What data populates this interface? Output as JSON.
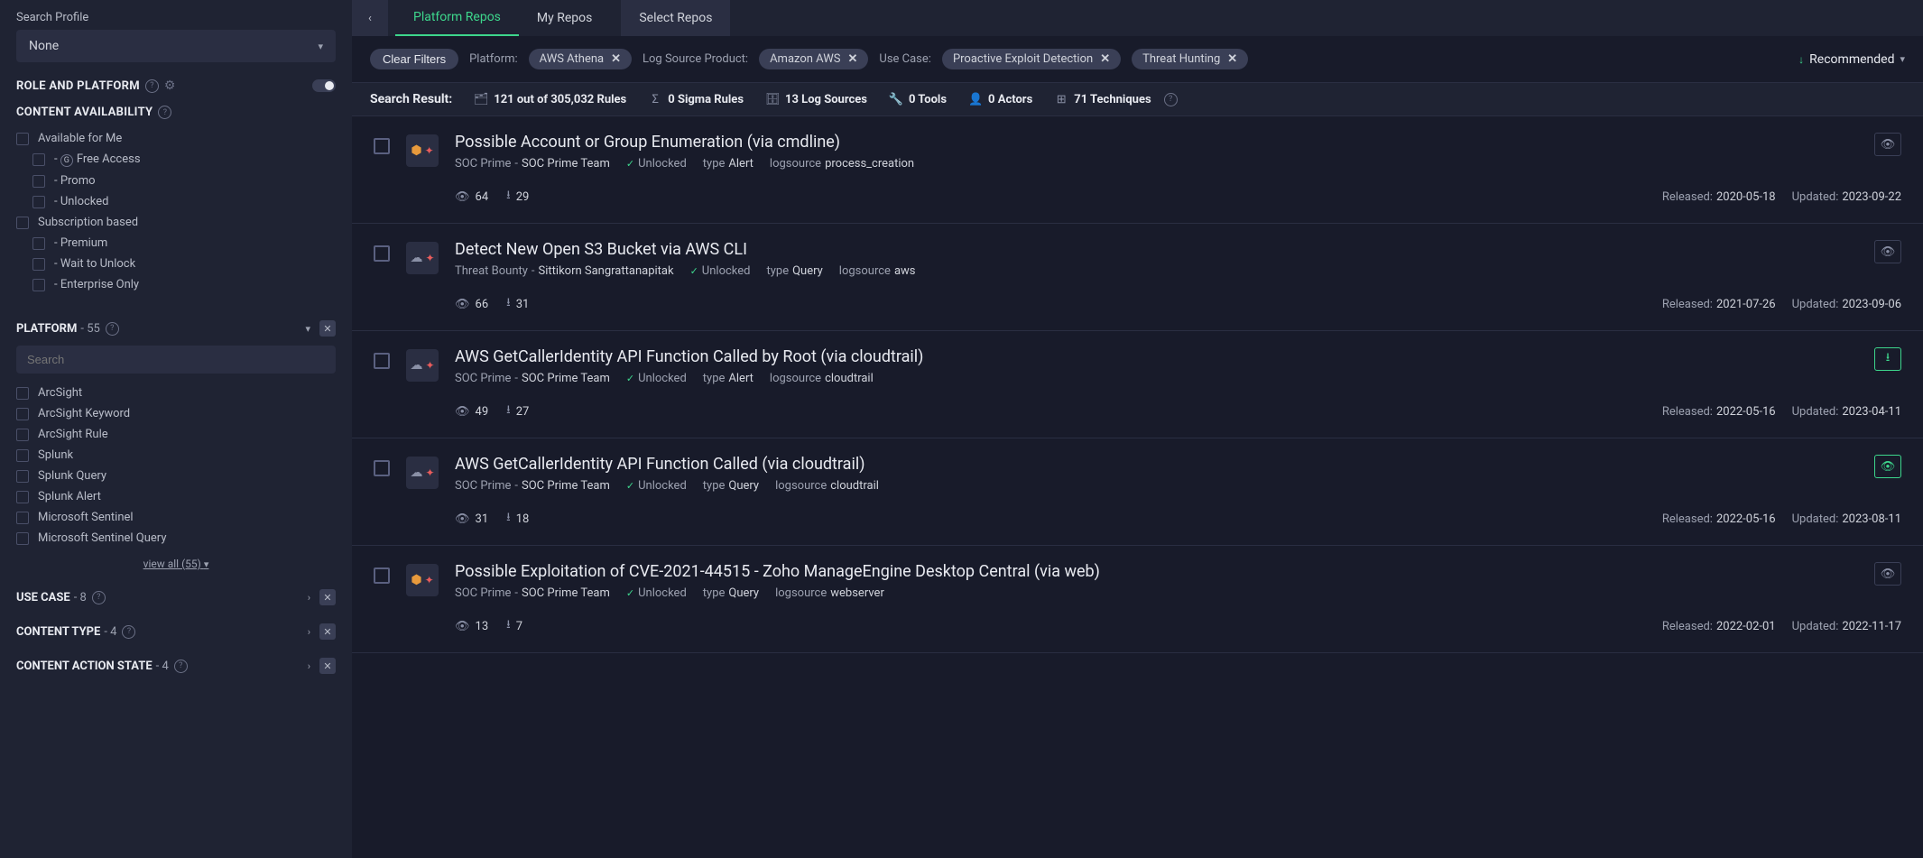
{
  "sidebar": {
    "search_profile_label": "Search Profile",
    "profile_value": "None",
    "role_platform_title": "ROLE AND PLATFORM",
    "content_availability_title": "CONTENT AVAILABILITY",
    "availability": [
      {
        "label": "Available for Me",
        "indent": false,
        "icon": false
      },
      {
        "label": "Free Access",
        "indent": true,
        "icon": true
      },
      {
        "label": "Promo",
        "indent": true,
        "icon": false
      },
      {
        "label": "Unlocked",
        "indent": true,
        "icon": false
      },
      {
        "label": "Subscription based",
        "indent": false,
        "icon": false
      },
      {
        "label": "Premium",
        "indent": true,
        "icon": false
      },
      {
        "label": "Wait to Unlock",
        "indent": true,
        "icon": false
      },
      {
        "label": "Enterprise Only",
        "indent": true,
        "icon": false
      }
    ],
    "platform_title": "PLATFORM",
    "platform_count": "55",
    "platform_search_placeholder": "Search",
    "platforms": [
      "ArcSight",
      "ArcSight Keyword",
      "ArcSight Rule",
      "Splunk",
      "Splunk Query",
      "Splunk Alert",
      "Microsoft Sentinel",
      "Microsoft Sentinel Query"
    ],
    "view_all_label": "view all (55)",
    "facets": [
      {
        "title": "USE CASE",
        "count": "8"
      },
      {
        "title": "CONTENT TYPE",
        "count": "4"
      },
      {
        "title": "CONTENT ACTION STATE",
        "count": "4"
      }
    ]
  },
  "tabs": {
    "platform": "Platform Repos",
    "my": "My Repos",
    "select": "Select Repos"
  },
  "filters": {
    "clear": "Clear Filters",
    "platform_label": "Platform:",
    "platform_value": "AWS Athena",
    "logsource_label": "Log Source Product:",
    "logsource_value": "Amazon AWS",
    "usecase_label": "Use Case:",
    "usecase_values": [
      "Proactive Exploit Detection",
      "Threat Hunting"
    ],
    "sort_label": "Recommended"
  },
  "stats": {
    "title": "Search Result:",
    "rules": "121 out of 305,032 Rules",
    "sigma": "0 Sigma Rules",
    "logsources": "13 Log Sources",
    "tools": "0 Tools",
    "actors": "0 Actors",
    "techniques": "71 Techniques"
  },
  "results": [
    {
      "title": "Possible Account or Group Enumeration (via cmdline)",
      "author_prefix": "SOC Prime",
      "author_name": "SOC Prime Team",
      "unlocked": "Unlocked",
      "type": "Alert",
      "logsource": "process_creation",
      "views": "64",
      "downloads": "29",
      "released": "2020-05-18",
      "updated": "2023-09-22",
      "icon_style": "shield",
      "action": "eye"
    },
    {
      "title": "Detect New Open S3 Bucket via AWS CLI",
      "author_prefix": "Threat Bounty",
      "author_name": "Sittikorn Sangrattanapitak",
      "unlocked": "Unlocked",
      "type": "Query",
      "logsource": "aws",
      "views": "66",
      "downloads": "31",
      "released": "2021-07-26",
      "updated": "2023-09-06",
      "icon_style": "cloud",
      "action": "eye"
    },
    {
      "title": "AWS GetCallerIdentity API Function Called by Root (via cloudtrail)",
      "author_prefix": "SOC Prime",
      "author_name": "SOC Prime Team",
      "unlocked": "Unlocked",
      "type": "Alert",
      "logsource": "cloudtrail",
      "views": "49",
      "downloads": "27",
      "released": "2022-05-16",
      "updated": "2023-04-11",
      "icon_style": "cloud",
      "action": "download-green"
    },
    {
      "title": "AWS GetCallerIdentity API Function Called (via cloudtrail)",
      "author_prefix": "SOC Prime",
      "author_name": "SOC Prime Team",
      "unlocked": "Unlocked",
      "type": "Query",
      "logsource": "cloudtrail",
      "views": "31",
      "downloads": "18",
      "released": "2022-05-16",
      "updated": "2023-08-11",
      "icon_style": "cloud",
      "action": "eye-green"
    },
    {
      "title": "Possible Exploitation of CVE-2021-44515 - Zoho ManageEngine Desktop Central (via web)",
      "author_prefix": "SOC Prime",
      "author_name": "SOC Prime Team",
      "unlocked": "Unlocked",
      "type": "Query",
      "logsource": "webserver",
      "views": "13",
      "downloads": "7",
      "released": "2022-02-01",
      "updated": "2022-11-17",
      "icon_style": "shield",
      "action": "eye"
    }
  ],
  "labels": {
    "type": "type",
    "logsource": "logsource",
    "released": "Released:",
    "updated": "Updated:"
  }
}
